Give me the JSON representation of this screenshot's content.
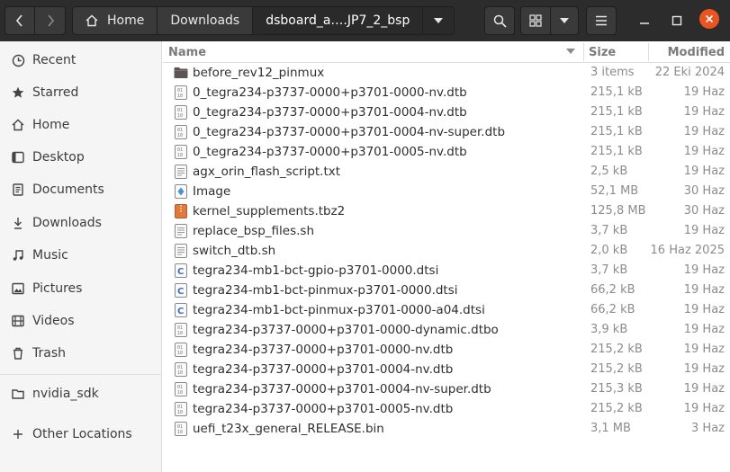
{
  "path": {
    "home_label": "Home",
    "segments": [
      "Downloads",
      "dsboard_a….JP7_2_bsp"
    ]
  },
  "sidebar": {
    "items": [
      {
        "label": "Recent",
        "icon": "clock-icon"
      },
      {
        "label": "Starred",
        "icon": "star-icon"
      },
      {
        "label": "Home",
        "icon": "home-icon"
      },
      {
        "label": "Desktop",
        "icon": "desktop-icon"
      },
      {
        "label": "Documents",
        "icon": "documents-icon"
      },
      {
        "label": "Downloads",
        "icon": "download-icon"
      },
      {
        "label": "Music",
        "icon": "music-icon"
      },
      {
        "label": "Pictures",
        "icon": "pictures-icon"
      },
      {
        "label": "Videos",
        "icon": "videos-icon"
      },
      {
        "label": "Trash",
        "icon": "trash-icon"
      },
      {
        "label": "nvidia_sdk",
        "icon": "folder-icon"
      },
      {
        "label": "Other Locations",
        "icon": "plus-icon"
      }
    ]
  },
  "columns": {
    "name": "Name",
    "size": "Size",
    "modified": "Modified"
  },
  "files": [
    {
      "name": "before_rev12_pinmux",
      "size": "3 items",
      "modified": "22 Eki 2024",
      "type": "folder"
    },
    {
      "name": "0_tegra234-p3737-0000+p3701-0000-nv.dtb",
      "size": "215,1 kB",
      "modified": "19 Haz",
      "type": "binary"
    },
    {
      "name": "0_tegra234-p3737-0000+p3701-0004-nv.dtb",
      "size": "215,1 kB",
      "modified": "19 Haz",
      "type": "binary"
    },
    {
      "name": "0_tegra234-p3737-0000+p3701-0004-nv-super.dtb",
      "size": "215,1 kB",
      "modified": "19 Haz",
      "type": "binary"
    },
    {
      "name": "0_tegra234-p3737-0000+p3701-0005-nv.dtb",
      "size": "215,1 kB",
      "modified": "19 Haz",
      "type": "binary"
    },
    {
      "name": "agx_orin_flash_script.txt",
      "size": "2,5 kB",
      "modified": "19 Haz",
      "type": "text"
    },
    {
      "name": "Image",
      "size": "52,1 MB",
      "modified": "30 Haz",
      "type": "image"
    },
    {
      "name": "kernel_supplements.tbz2",
      "size": "125,8 MB",
      "modified": "30 Haz",
      "type": "archive"
    },
    {
      "name": "replace_bsp_files.sh",
      "size": "3,7 kB",
      "modified": "19 Haz",
      "type": "text"
    },
    {
      "name": "switch_dtb.sh",
      "size": "2,0 kB",
      "modified": "16 Haz 2025",
      "type": "text"
    },
    {
      "name": "tegra234-mb1-bct-gpio-p3701-0000.dtsi",
      "size": "3,7 kB",
      "modified": "19 Haz",
      "type": "source"
    },
    {
      "name": "tegra234-mb1-bct-pinmux-p3701-0000.dtsi",
      "size": "66,2 kB",
      "modified": "19 Haz",
      "type": "source"
    },
    {
      "name": "tegra234-mb1-bct-pinmux-p3701-0000-a04.dtsi",
      "size": "66,2 kB",
      "modified": "19 Haz",
      "type": "source"
    },
    {
      "name": "tegra234-p3737-0000+p3701-0000-dynamic.dtbo",
      "size": "3,9 kB",
      "modified": "19 Haz",
      "type": "binary"
    },
    {
      "name": "tegra234-p3737-0000+p3701-0000-nv.dtb",
      "size": "215,2 kB",
      "modified": "19 Haz",
      "type": "binary"
    },
    {
      "name": "tegra234-p3737-0000+p3701-0004-nv.dtb",
      "size": "215,2 kB",
      "modified": "19 Haz",
      "type": "binary"
    },
    {
      "name": "tegra234-p3737-0000+p3701-0004-nv-super.dtb",
      "size": "215,3 kB",
      "modified": "19 Haz",
      "type": "binary"
    },
    {
      "name": "tegra234-p3737-0000+p3701-0005-nv.dtb",
      "size": "215,2 kB",
      "modified": "19 Haz",
      "type": "binary"
    },
    {
      "name": "uefi_t23x_general_RELEASE.bin",
      "size": "3,1 MB",
      "modified": "3 Haz",
      "type": "binary"
    }
  ],
  "colors": {
    "headerbar": "#2c2c2c",
    "close_button": "#e95420",
    "folder": "#5d5555",
    "archive": "#e07a3c",
    "source": "#3f6fc0",
    "image": "#4a90d9"
  }
}
